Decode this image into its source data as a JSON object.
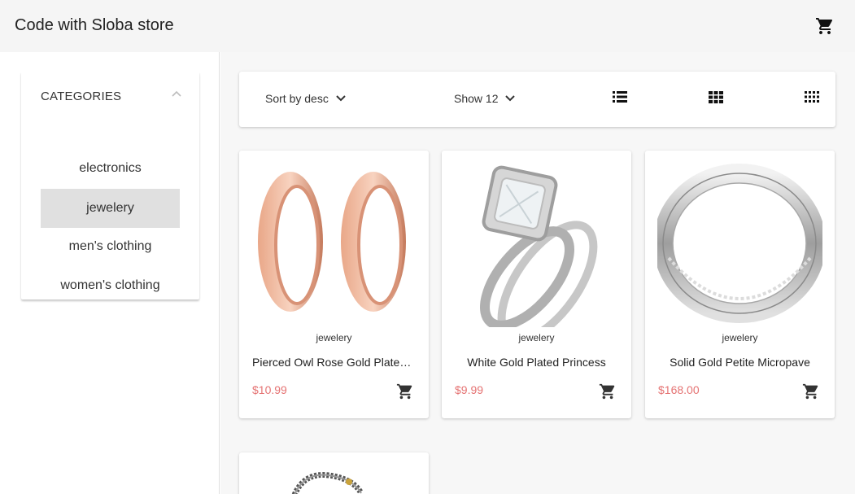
{
  "app": {
    "title": "Code with Sloba store",
    "cart_icon": "shopping-cart-icon"
  },
  "sidebar": {
    "header": "CATEGORIES",
    "items": [
      {
        "label": "electronics",
        "active": false
      },
      {
        "label": "jewelery",
        "active": true
      },
      {
        "label": "men's clothing",
        "active": false
      },
      {
        "label": "women's clothing",
        "active": false
      }
    ]
  },
  "toolbar": {
    "sort_label": "Sort by desc",
    "show_label": "Show 12",
    "view_icons": [
      "list-view-icon",
      "grid-view-icon",
      "dense-grid-view-icon"
    ]
  },
  "products": [
    {
      "category": "jewelery",
      "name": "Pierced Owl Rose Gold Plated Stainless Steel Double",
      "price": "$10.99"
    },
    {
      "category": "jewelery",
      "name": "White Gold Plated Princess",
      "price": "$9.99"
    },
    {
      "category": "jewelery",
      "name": "Solid Gold Petite Micropave",
      "price": "$168.00"
    }
  ],
  "colors": {
    "price": "#e57373",
    "active_category_bg": "#e0e0e0",
    "topbar_bg": "#f5f5f5"
  }
}
